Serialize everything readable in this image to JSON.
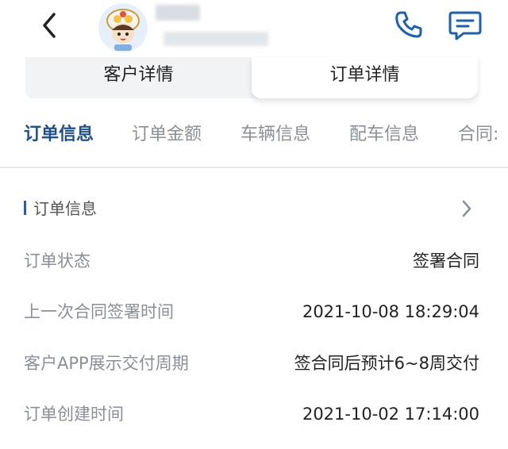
{
  "header": {
    "back_icon": "chevron-left-icon",
    "phone_icon": "phone-icon",
    "chat_icon": "chat-icon",
    "accent_color": "#1b5fb6"
  },
  "segment": {
    "tabs": [
      {
        "label": "客户详情",
        "selected": false
      },
      {
        "label": "订单详情",
        "selected": true
      }
    ]
  },
  "subtabs": [
    {
      "label": "订单信息",
      "active": true
    },
    {
      "label": "订单金额",
      "active": false
    },
    {
      "label": "车辆信息",
      "active": false
    },
    {
      "label": "配车信息",
      "active": false
    },
    {
      "label": "合同:",
      "active": false
    }
  ],
  "section": {
    "title": "订单信息",
    "rows": [
      {
        "label": "订单状态",
        "value": "签署合同"
      },
      {
        "label": "上一次合同签署时间",
        "value": "2021-10-08 18:29:04"
      },
      {
        "label": "客户APP展示交付周期",
        "value": "签合同后预计6~8周交付"
      },
      {
        "label": "订单创建时间",
        "value": "2021-10-02 17:14:00"
      }
    ]
  }
}
